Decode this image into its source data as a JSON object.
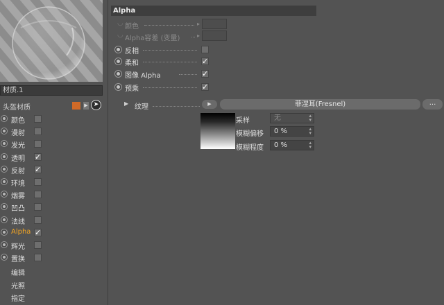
{
  "material": {
    "name": "材质.1",
    "type_label": "头盔材质",
    "swatch_color": "#d06a28"
  },
  "channels": [
    {
      "label": "颜色",
      "checked": false,
      "active": false
    },
    {
      "label": "漫射",
      "checked": false,
      "active": false
    },
    {
      "label": "发光",
      "checked": false,
      "active": false
    },
    {
      "label": "透明",
      "checked": true,
      "active": false
    },
    {
      "label": "反射",
      "checked": true,
      "active": false
    },
    {
      "label": "环境",
      "checked": false,
      "active": false
    },
    {
      "label": "烟雾",
      "checked": false,
      "active": false
    },
    {
      "label": "凹凸",
      "checked": false,
      "active": false
    },
    {
      "label": "法线",
      "checked": false,
      "active": false
    },
    {
      "label": "Alpha",
      "checked": true,
      "active": true
    },
    {
      "label": "辉光",
      "checked": false,
      "active": false
    },
    {
      "label": "置换",
      "checked": false,
      "active": false
    }
  ],
  "nav_items": [
    "编辑",
    "光照",
    "指定"
  ],
  "panel": {
    "title": "Alpha",
    "properties": [
      {
        "label": "颜色",
        "kind": "field",
        "dim": true
      },
      {
        "label": "Alpha容差 (变量)",
        "kind": "field",
        "dim": true
      },
      {
        "label": "反相",
        "kind": "checkbox",
        "checked": false
      },
      {
        "label": "柔和",
        "kind": "checkbox",
        "checked": true
      },
      {
        "label": "图像 Alpha",
        "kind": "checkbox",
        "checked": true
      },
      {
        "label": "预乘",
        "kind": "checkbox",
        "checked": true
      }
    ],
    "texture": {
      "label": "纹理",
      "button_label": "菲涅耳(Fresnel)",
      "more_label": "..."
    },
    "sampling": {
      "label": "采样",
      "value": "无"
    },
    "blur_offset": {
      "label": "模糊偏移",
      "value": "0 %"
    },
    "blur_scale": {
      "label": "模糊程度",
      "value": "0 %"
    }
  },
  "colors": {
    "accent_active": "#f5a623",
    "panel_bg": "#535353"
  }
}
